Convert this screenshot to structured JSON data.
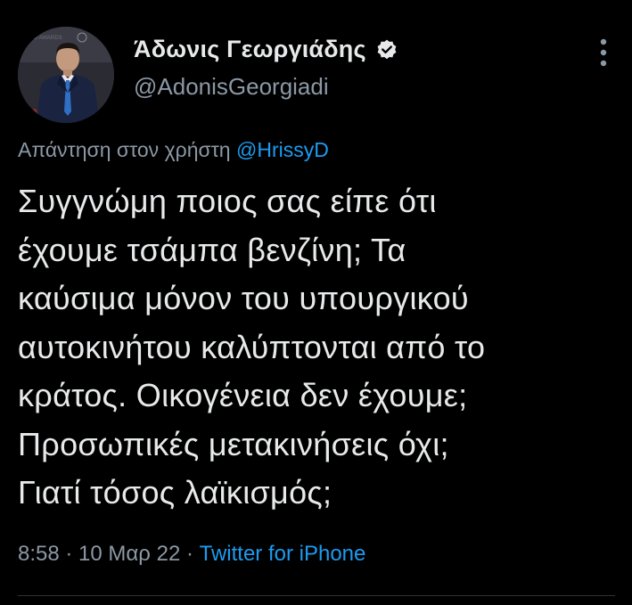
{
  "author": {
    "display_name": "Άδωνις Γεωργιάδης",
    "handle": "@AdonisGeorgiadi",
    "verified_icon": "verified-badge-icon",
    "avatar_backdrop_text": "BOLD AWARDS"
  },
  "reply": {
    "prefix": "Απάντηση στον χρήστη",
    "mention": "@HrissyD"
  },
  "tweet": {
    "text": "Συγγνώμη ποιος σας είπε ότι\nέχουμε τσάμπα βενζίνη; Τα\nκαύσιμα μόνον του υπουργικού\nαυτοκινήτου καλύπτονται από το\nκράτος. Οικογένεια δεν έχουμε;\nΠροσωπικές μετακινήσεις όχι;\nΓιατί τόσος λαϊκισμός;"
  },
  "meta": {
    "time": "8:58",
    "separator": " · ",
    "date": "10 Μαρ 22",
    "source": "Twitter for iPhone"
  },
  "colors": {
    "background": "#000000",
    "text": "#e7e9ea",
    "secondary": "#8b98a5",
    "link": "#1d9bf0",
    "divider": "#2f3336"
  },
  "icons": {
    "more": "more-vertical-icon"
  }
}
